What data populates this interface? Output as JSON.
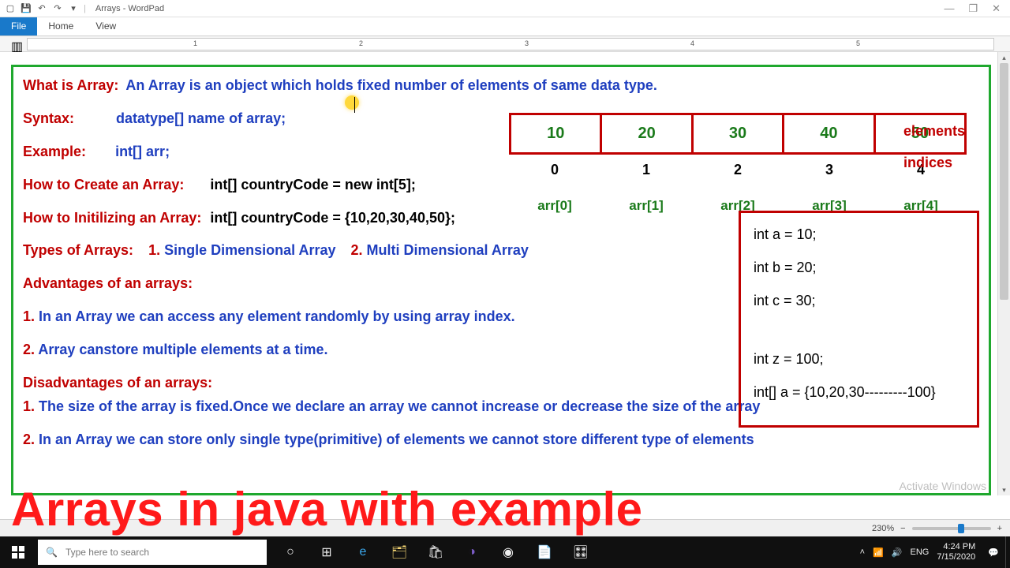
{
  "app": {
    "title": "Arrays - WordPad",
    "tabs": {
      "file": "File",
      "home": "Home",
      "view": "View"
    }
  },
  "ruler": {
    "n1": "1",
    "n2": "2",
    "n3": "3",
    "n4": "4",
    "n5": "5"
  },
  "doc": {
    "l1a": "What is Array:",
    "l1b": "An Array is an object which holds fixed number of elements of same data type.",
    "syntax_label": "Syntax:",
    "syntax_val": "datatype[]   name of array;",
    "example_label": "Example:",
    "example_val": "int[]  arr;",
    "create_label": "How to Create an Array:",
    "create_val": "int[]  countryCode = new int[5];",
    "init_label": "How to Initilizing an Array:",
    "init_val": "int[] countryCode  =  {10,20,30,40,50};",
    "types_label": "Types of Arrays:",
    "types_1n": "1.",
    "types_1": " Single Dimensional Array",
    "types_2n": "2.",
    "types_2": " Multi Dimensional Array",
    "adv_label": "Advantages of an arrays:",
    "adv_1n": "1.",
    "adv_1": " In an Array we can access any element randomly by using array index.",
    "adv_2n": "2.",
    "adv_2": " Array canstore multiple elements at a time.",
    "dis_label": "Disadvantages of an arrays:",
    "dis_1n": "1.",
    "dis_1": " The size of the array is fixed.Once we declare an array we cannot increase or decrease the size of the array",
    "dis_2n": "2.",
    "dis_2": " In an Array we can store only single type(primitive) of elements we cannot store different type of elements"
  },
  "arr": {
    "cells": [
      "10",
      "20",
      "30",
      "40",
      "50"
    ],
    "idx": [
      "0",
      "1",
      "2",
      "3",
      "4"
    ],
    "ref": [
      "arr[0]",
      "arr[1]",
      "arr[2]",
      "arr[3]",
      "arr[4]"
    ],
    "elements_label": "elements",
    "indices_label": "indices"
  },
  "exbox": {
    "a": "int a = 10;",
    "b": "int b = 20;",
    "c": "int c = 30;",
    "z": "int z = 100;",
    "arr": " int[]  a = {10,20,30---------100}"
  },
  "watermark": "Activate Windows",
  "zoom": "230%",
  "caption": "Arrays in java with example",
  "taskbar": {
    "search_placeholder": "Type here to search",
    "lang": "ENG",
    "time": "4:24 PM",
    "date": "7/15/2020"
  }
}
